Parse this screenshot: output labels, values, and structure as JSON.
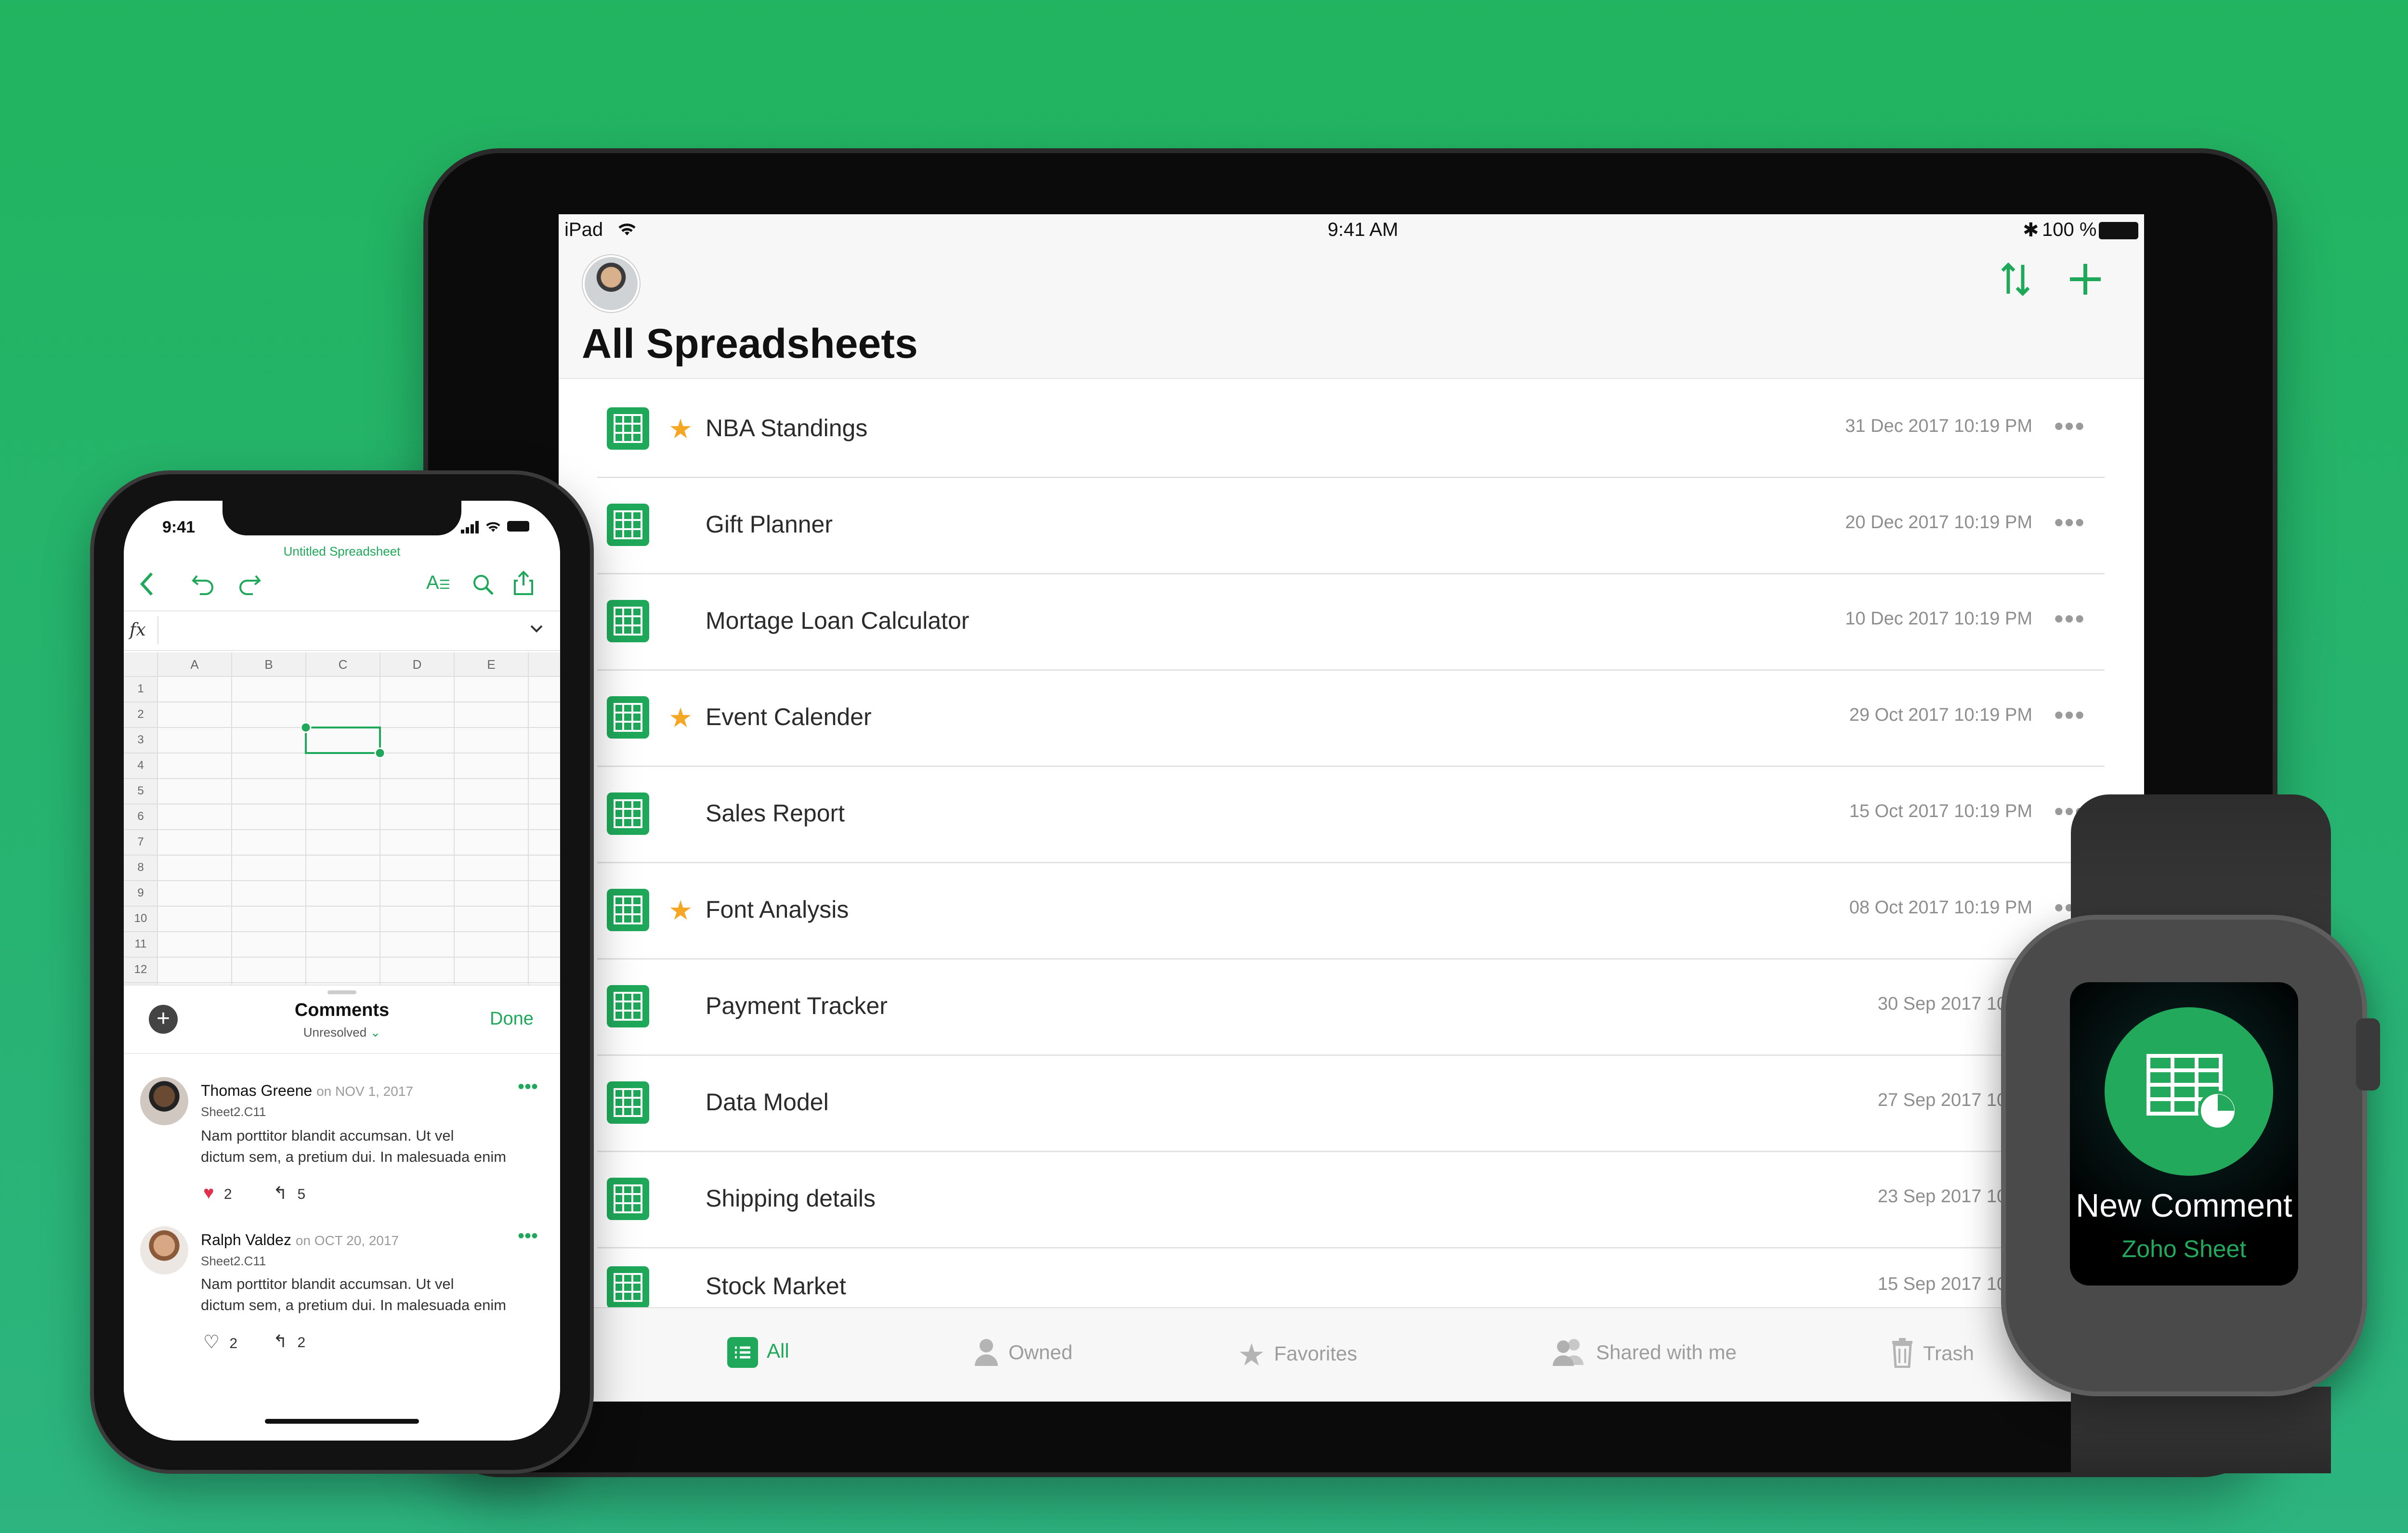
{
  "ipad": {
    "status": {
      "carrier": "iPad",
      "time": "9:41 AM",
      "battery": "100 %"
    },
    "title": "All Spreadsheets",
    "toolbar": {
      "sort_icon": "sort-icon",
      "add_icon": "plus-icon"
    },
    "files": [
      {
        "name": "NBA Standings",
        "date": "31 Dec 2017 10:19 PM",
        "starred": true
      },
      {
        "name": "Gift Planner",
        "date": "20 Dec 2017 10:19 PM",
        "starred": false
      },
      {
        "name": "Mortage Loan Calculator",
        "date": "10 Dec 2017 10:19 PM",
        "starred": false
      },
      {
        "name": "Event Calender",
        "date": "29 Oct 2017 10:19 PM",
        "starred": true
      },
      {
        "name": "Sales Report",
        "date": "15 Oct 2017 10:19 PM",
        "starred": false
      },
      {
        "name": "Font Analysis",
        "date": "08 Oct 2017 10:19 PM",
        "starred": true
      },
      {
        "name": "Payment Tracker",
        "date": "30 Sep 2017 10:19",
        "starred": false
      },
      {
        "name": "Data Model",
        "date": "27 Sep 2017 10:19",
        "starred": false
      },
      {
        "name": "Shipping details",
        "date": "23 Sep 2017 10:19",
        "starred": false
      },
      {
        "name": "Stock Market",
        "date": "15 Sep 2017 10:19",
        "starred": false
      }
    ],
    "more_glyph": "•••",
    "star_glyph": "★",
    "tabs": [
      "All",
      "Owned",
      "Favorites",
      "Shared with me",
      "Trash"
    ]
  },
  "iphone": {
    "time": "9:41",
    "doc_title": "Untitled Spreadsheet",
    "fx_label": "fx",
    "columns": [
      "A",
      "B",
      "C",
      "D",
      "E"
    ],
    "rows": [
      "1",
      "2",
      "3",
      "4",
      "5",
      "6",
      "7",
      "8",
      "9",
      "10",
      "11",
      "12"
    ],
    "comments_title": "Comments",
    "filter": "Unresolved",
    "done": "Done",
    "comments": [
      {
        "author": "Thomas Greene",
        "date": "on NOV 1, 2017",
        "ref": "Sheet2.C11",
        "body_line1": "Nam porttitor blandit accumsan. Ut vel",
        "body_line2": "dictum sem, a pretium dui. In malesuada enim",
        "likes": "2",
        "replies": "5",
        "liked": true
      },
      {
        "author": "Ralph Valdez",
        "date": "on OCT 20, 2017",
        "ref": "Sheet2.C11",
        "body_line1": "Nam porttitor blandit accumsan. Ut vel",
        "body_line2": "dictum sem, a pretium dui. In malesuada enim",
        "likes": "2",
        "replies": "2",
        "liked": false
      }
    ],
    "more_glyph": "•••"
  },
  "watch": {
    "title": "New Comment",
    "subtitle": "Zoho Sheet"
  },
  "colors": {
    "brand_green": "#1fa85a",
    "background_green": "#24b466",
    "star": "#f5a623"
  }
}
